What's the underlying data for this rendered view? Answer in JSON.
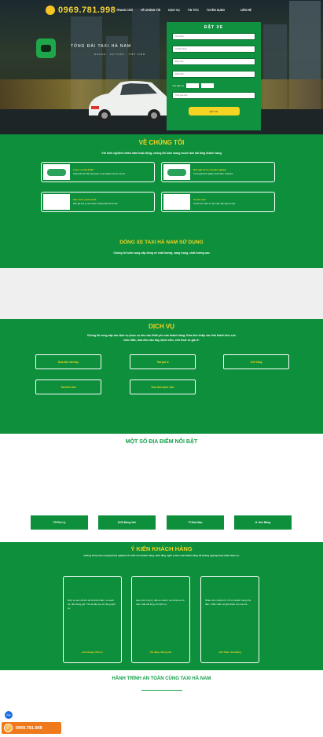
{
  "header": {
    "phone": "0969.781.998",
    "nav": [
      "TRANG CHỦ",
      "VỀ CHÚNG TÔI",
      "DỊCH VỤ",
      "TIN TỨC",
      "TUYỂN DỤNG",
      "LIÊN HỆ"
    ],
    "brand": "TỔNG ĐÀI TAXI HÀ NAM",
    "brand_sub": "NHANH · AN TOÀN · TIẾT KIỆM"
  },
  "booking": {
    "title": "ĐẶT XE",
    "fields": [
      "Họ và tên",
      "Số điện thoại",
      "Điểm đón",
      "Điểm đến"
    ],
    "car_label": "Yêu cầu xe",
    "car_options": [
      "Xe 4 chỗ",
      "Xe 7 chỗ"
    ],
    "time_placeholder": "Thời gian đón",
    "submit": "ĐẶT XE"
  },
  "about": {
    "title": "VỀ CHÚNG TÔI",
    "subtitle": "Với kinh nghiệm nhiều năm hoạt động, chúng tôi luôn mang muốn làm hài lòng khách hàng",
    "features": [
      {
        "title": "Luôn có mặt 24/24",
        "desc": "Chúng tôi luôn sẵn sàng phục vụ quý khách mọi lúc mọi nơi"
      },
      {
        "title": "Đội ngũ tài xế chuyên nghiệp",
        "desc": "Tài xế giàu kinh nghiệm, thân thiện, nhiệt tình"
      },
      {
        "title": "Giá cước cạnh tranh",
        "desc": "Mức giá hợp lý, minh bạch, không phát sinh chi phí"
      },
      {
        "title": "Xe đời mới",
        "desc": "Xe đời mới, sạch sẽ, tiện nghi, đảm bảo an toàn"
      }
    ],
    "fleet_title": "DÒNG XE TAXI HÀ NAM SỬ DỤNG",
    "fleet_sub": "Chúng tôi luôn cung cấp dòng xe chất lượng, sang trọng, chất lượng cao"
  },
  "services": {
    "title": "DỊCH VỤ",
    "subtitle": "Chúng tôi cung cấp các dịch vụ phục vụ nhu cầu thiết yếu của khách hàng: Đưa đón khắp các tỉnh thành khu vực miền Bắc, đưa đón sân bay, bệnh viện, chở thuê xe giá rẻ.",
    "items": [
      "Đưa đón sân bay",
      "Taxi giá rẻ",
      "Chở hàng",
      "Taxi liên tỉnh",
      "Đưa đón bệnh viện"
    ]
  },
  "places": {
    "title": "MỘT SỐ ĐỊA ĐIỂM NỔI BẬT",
    "items": [
      "TP.Phủ Lý",
      "KCN Đồng Văn",
      "TT.Hòa Mạc",
      "H. Kim Bảng"
    ]
  },
  "reviews": {
    "title": "Ý KIẾN KHÁCH HÀNG",
    "intro": "Chúng tôi tự hào mang lại trải nghiệm tốt nhất cho khách hàng, luôn lắng nghe ý kiến của khách hàng để không ngừng hoàn thiện dịch vụ.",
    "items": [
      {
        "text": "Dịch vụ taxi rất tốt, tài xế thân thiện, xe sạch sẽ, đón đúng giờ. Tôi sẽ tiếp tục sử dụng dịch vụ.",
        "name": "Anh Hoàng / Phủ Lý"
      },
      {
        "text": "Giá cước hợp lý, đặt xe nhanh, tài xế lái xe an toàn. Rất hài lòng với dịch vụ.",
        "name": "Chị Hằng / Đồng Văn"
      },
      {
        "text": "Nhân viên nhiệt tình, hỗ trợ khách hàng chu đáo. Chắc chắn sẽ giới thiệu cho bạn bè.",
        "name": "Anh Tuấn / Kim Bảng"
      }
    ]
  },
  "journey": {
    "title": "HÀNH TRÌNH AN TOÀN CÙNG TAXI HÀ NAM"
  },
  "float": {
    "zalo": "Zalo",
    "call": "0969.781.998"
  }
}
